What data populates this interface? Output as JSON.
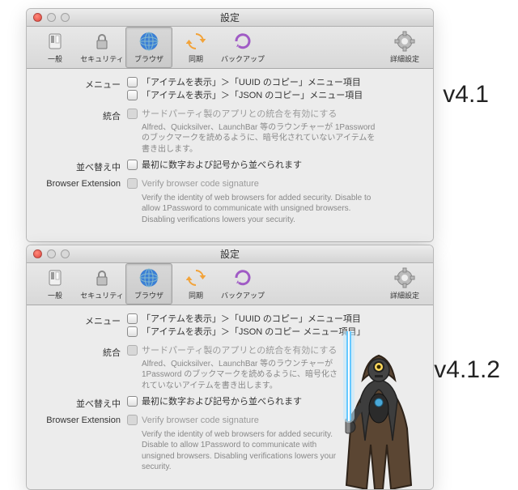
{
  "versions": {
    "v41": "v4.1",
    "v412": "v4.1.2"
  },
  "window": {
    "title": "設定"
  },
  "toolbar": {
    "general": "一般",
    "security": "セキュリティ",
    "browser": "ブラウザ",
    "sync": "同期",
    "backup": "バックアップ",
    "advanced": "詳細設定"
  },
  "panels": {
    "v41": {
      "menu": {
        "label": "メニュー",
        "item1": "「アイテムを表示」＞「UUID のコピー」メニュー項目",
        "item2": "「アイテムを表示」＞「JSON のコピー」メニュー項目"
      },
      "integration": {
        "label": "統合",
        "check": "サードパーティ製のアプリとの統合を有効にする",
        "desc": "Alfred、Quicksilver、LaunchBar 等のラウンチャーが 1Password のブックマークを読めるように、暗号化されていないアイテムを書き出します。"
      },
      "sort": {
        "label": "並べ替え中",
        "check": "最初に数字および記号から並べられます"
      },
      "browser_ext": {
        "label": "Browser Extension",
        "check": "Verify browser code signature",
        "desc": "Verify the identity of web browsers for added security. Disable to allow 1Password to communicate with unsigned browsers. Disabling verifications lowers your security."
      }
    },
    "v412": {
      "menu": {
        "label": "メニュー",
        "item1": "「アイテムを表示」＞「UUID のコピー」メニュー項目",
        "item2": "「アイテムを表示」＞「JSON のコピー メニュー項目」"
      },
      "integration": {
        "label": "統合",
        "check": "サードパーティ製のアプリとの統合を有効にする",
        "desc": "Alfred、Quicksilver、LaunchBar 等のラウンチャーが 1Password のブックマークを読めるように、暗号化されていないアイテムを書き出します。"
      },
      "sort": {
        "label": "並べ替え中",
        "check": "最初に数字および記号から並べられます"
      },
      "browser_ext": {
        "label": "Browser Extension",
        "check": "Verify browser code signature",
        "desc": "Verify the identity of web browsers for added security. Disable to allow 1Password to communicate with unsigned browsers. Disabling verifications lowers your security."
      }
    }
  }
}
